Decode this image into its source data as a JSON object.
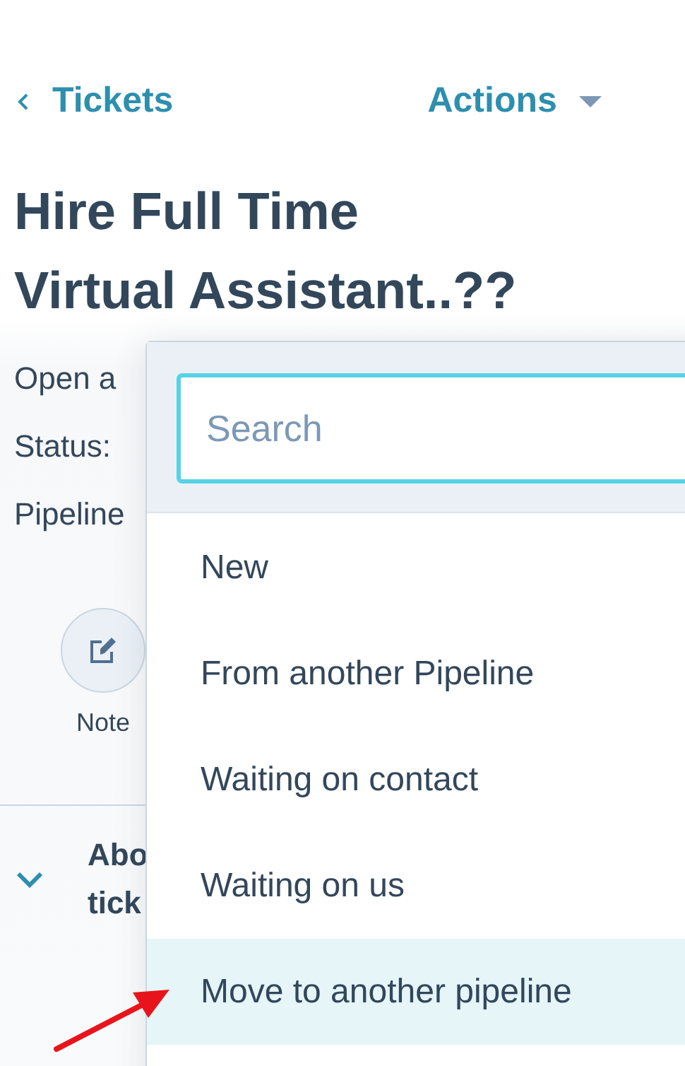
{
  "header": {
    "back_link": "Tickets",
    "actions": "Actions"
  },
  "title": "Hire Full Time Virtual Assistant..??",
  "properties": [
    "Open a",
    "Status:",
    "Pipeline"
  ],
  "quick_actions": [
    {
      "label": "Note"
    }
  ],
  "section": {
    "title_lines": [
      "Abo",
      "tick"
    ],
    "expanded": true
  },
  "dropdown": {
    "search": {
      "placeholder": "Search",
      "focused": true
    },
    "options": [
      {
        "label": "New",
        "selected": false
      },
      {
        "label": "From another Pipeline",
        "selected": false
      },
      {
        "label": "Waiting on contact",
        "selected": false
      },
      {
        "label": "Waiting on us",
        "selected": false
      },
      {
        "label": "Move to another pipeline",
        "selected": true
      }
    ]
  }
}
